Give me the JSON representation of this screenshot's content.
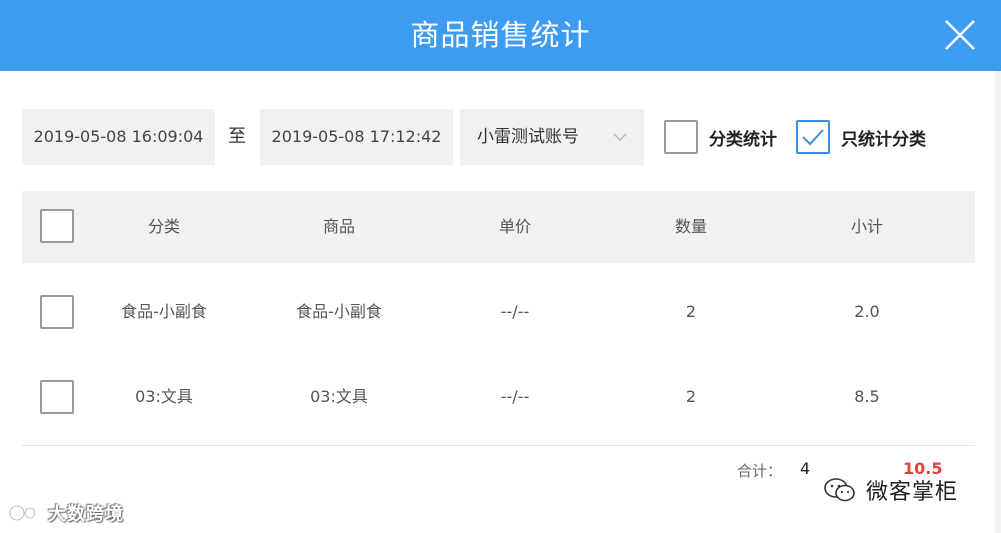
{
  "dialog": {
    "title": "商品销售统计",
    "close_icon": "close-icon"
  },
  "filters": {
    "start_datetime": "2019-05-08 16:09:04",
    "to_label": "至",
    "end_datetime": "2019-05-08 17:12:42",
    "account": "小雷测试账号",
    "account_icon": "chevron-down-icon",
    "category_stats_label": "分类统计",
    "category_stats_checked": false,
    "only_category_label": "只统计分类",
    "only_category_checked": true
  },
  "table": {
    "columns": [
      "分类",
      "商品",
      "单价",
      "数量",
      "小计"
    ],
    "rows": [
      {
        "category": "食品-小副食",
        "product": "食品-小副食",
        "unit_price": "--/--",
        "quantity": "2",
        "subtotal": "2.0",
        "checked": false
      },
      {
        "category": "03:文具",
        "product": "03:文具",
        "unit_price": "--/--",
        "quantity": "2",
        "subtotal": "8.5",
        "checked": false
      }
    ]
  },
  "totals": {
    "label": "合计：",
    "quantity": "4",
    "amount": "10.5"
  },
  "watermarks": {
    "left_text": "大数跨境",
    "right_text": "微客掌柜"
  },
  "colors": {
    "header": "#3d9cf2",
    "checked": "#3d8de0",
    "total_amount": "#e0433a"
  }
}
